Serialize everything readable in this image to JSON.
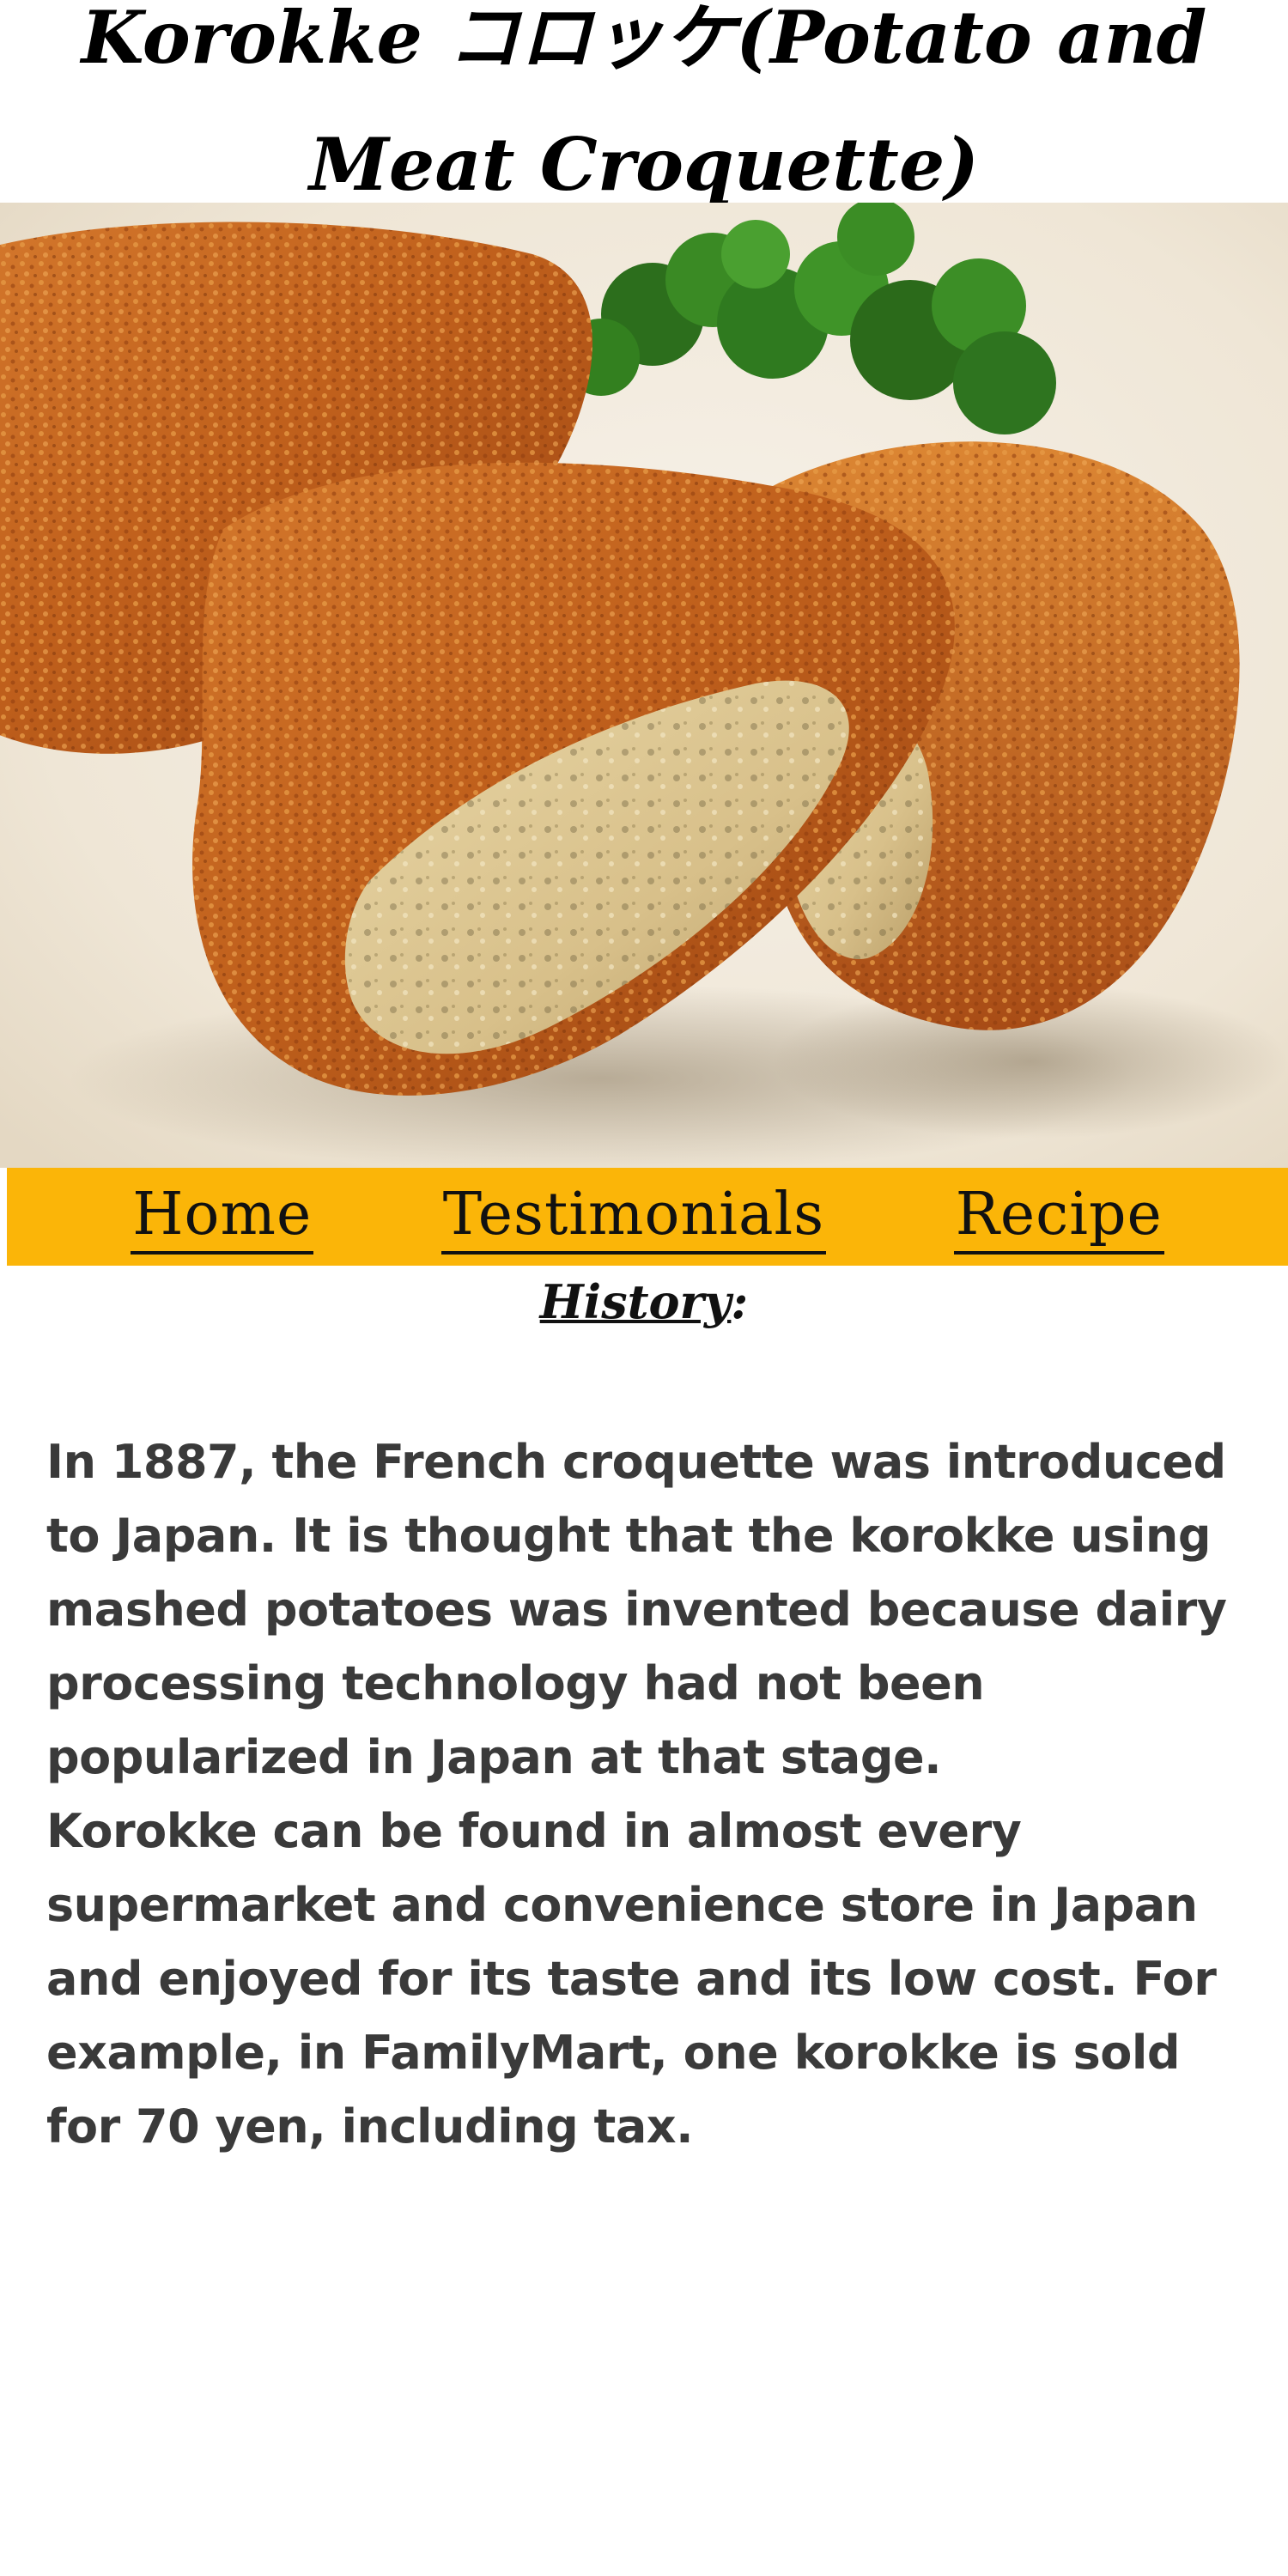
{
  "page": {
    "title_line1": "Korokke コロッケ(Potato and",
    "title_line2": "Meat Croquette)"
  },
  "hero": {
    "image_alt": "Korokke croquettes with parsley"
  },
  "nav": {
    "items": [
      {
        "label": "Home"
      },
      {
        "label": "Testimonials"
      },
      {
        "label": "Recipe"
      }
    ],
    "background": "#fbb508"
  },
  "history": {
    "heading": "History",
    "heading_suffix": ":",
    "paragraph1": "In 1887, the French croquette was introduced to Japan. It is thought that the korokke using mashed potatoes was invented because dairy processing technology had not been popularized in Japan at that stage.",
    "paragraph2": "Korokke can be found in almost every supermarket and convenience store in Japan and enjoyed for its taste and its low cost. For example, in FamilyMart, one korokke is sold for 70 yen, including tax."
  }
}
